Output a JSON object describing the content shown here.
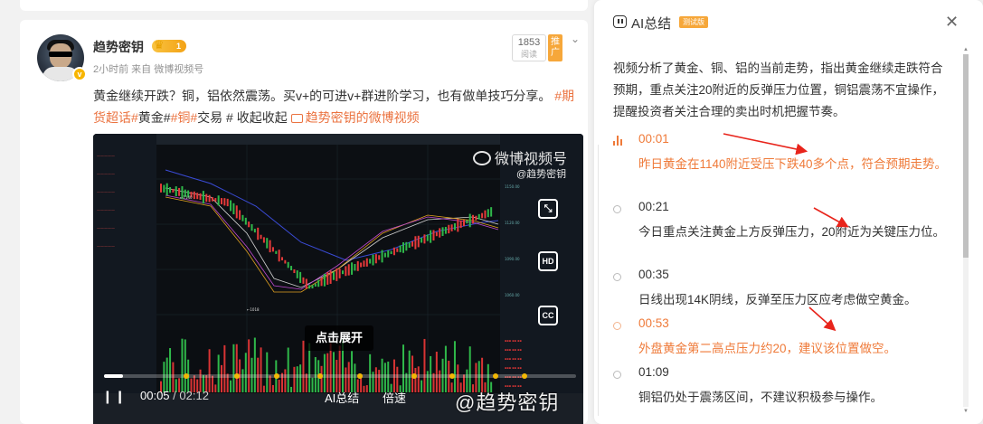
{
  "post": {
    "username": "趋势密钥",
    "badge_level": "1",
    "meta": "2小时前  来自 微博视频号",
    "text_main": "黄金继续开跌？铜，铝依然震荡。买v+的可进v+群进阶学习，也有做单技巧分享。",
    "tags": [
      "#期货超话#",
      "黄金#",
      "#铜#",
      "交易 # 收起收起 "
    ],
    "video_link": "趋势密钥的微博视频",
    "read_count": "1853",
    "read_label": "阅读",
    "push_label": "推广"
  },
  "video": {
    "watermark": "微博视频号",
    "watermark_sub": "@趋势密钥",
    "expand_tip": "点击展开",
    "time_current": "00:05",
    "time_total": "/ 02:12",
    "ai_label": "AI总结",
    "speed_label": "倍速",
    "watermark_bottom": "@趋势密钥",
    "progress_fraction": 0.04,
    "side_icons": [
      "crop-icon",
      "hd-icon",
      "subtitle-icon"
    ],
    "hd_label": "HD",
    "cc_label": "CC"
  },
  "ai_panel": {
    "title": "AI总结",
    "beta": "测试版",
    "summary": "视频分析了黄金、铜、铝的当前走势，指出黄金继续走跌符合预期，重点关注20附近的反弹压力位置，铜铝震荡不宜操作，提醒投资者关注合理的卖出时机把握节奏。",
    "timeline": [
      {
        "time": "00:01",
        "text": "昨日黄金在1140附近受压下跌40多个点，符合预期走势。"
      },
      {
        "time": "00:21",
        "text": "今日重点关注黄金上方反弹压力，20附近为关键压力位。"
      },
      {
        "time": "00:35",
        "text": "日线出现14K阴线，反弹至压力区应考虑做空黄金。"
      },
      {
        "time": "00:53",
        "text": "外盘黄金第二高点压力约20，建议该位置做空。"
      },
      {
        "time": "01:09",
        "text": "铜铝仍处于震荡区间，不建议积极参与操作。"
      }
    ]
  },
  "colors": {
    "accent": "#eb7340",
    "arrow_red": "#e8241b",
    "badge_gold": "#f3a215",
    "video_bg": "#0f1318"
  }
}
